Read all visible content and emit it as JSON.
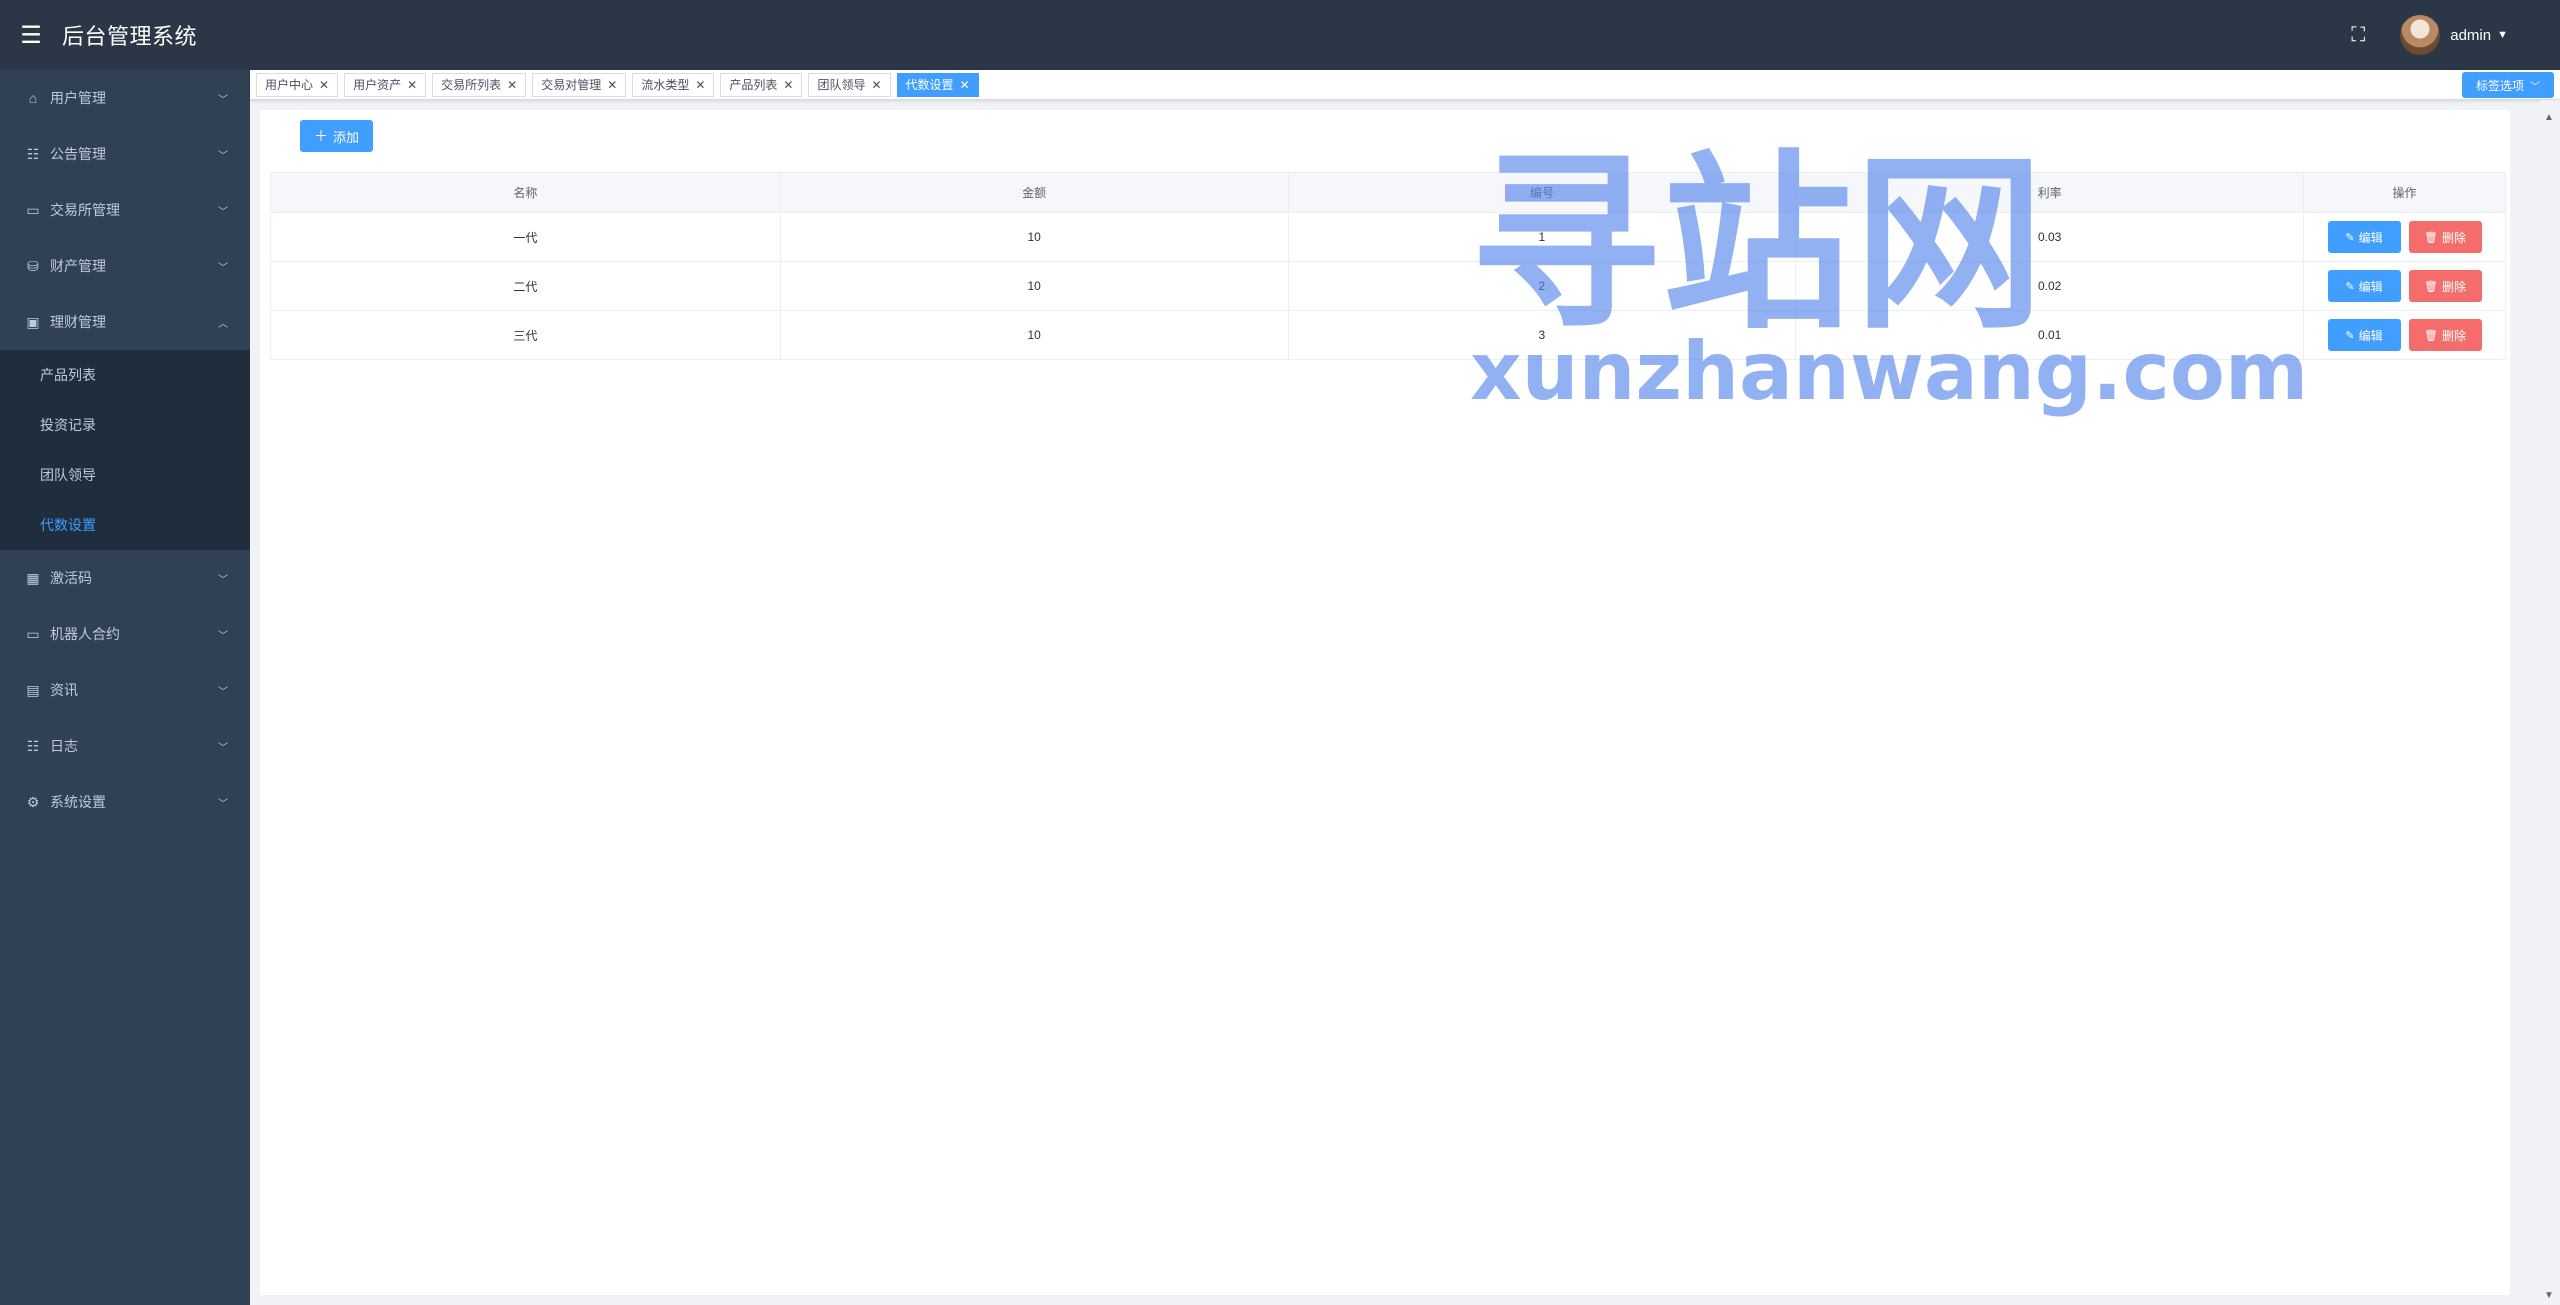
{
  "header": {
    "menu_icon": "hamburger-icon",
    "title": "后台管理系统",
    "fullscreen_icon": "fullscreen-icon",
    "username": "admin"
  },
  "sidebar": {
    "items": [
      {
        "label": "用户管理",
        "icon": "home-icon",
        "expanded": false
      },
      {
        "label": "公告管理",
        "icon": "list-icon",
        "expanded": false
      },
      {
        "label": "交易所管理",
        "icon": "presentation-icon",
        "expanded": false
      },
      {
        "label": "财产管理",
        "icon": "database-icon",
        "expanded": false
      },
      {
        "label": "理财管理",
        "icon": "bag-icon",
        "expanded": true,
        "children": [
          {
            "label": "产品列表",
            "active": false
          },
          {
            "label": "投资记录",
            "active": false
          },
          {
            "label": "团队领导",
            "active": false
          },
          {
            "label": "代数设置",
            "active": true
          }
        ]
      },
      {
        "label": "激活码",
        "icon": "grid-icon",
        "expanded": false
      },
      {
        "label": "机器人合约",
        "icon": "presentation-icon",
        "expanded": false
      },
      {
        "label": "资讯",
        "icon": "document-icon",
        "expanded": false
      },
      {
        "label": "日志",
        "icon": "list-icon",
        "expanded": false
      },
      {
        "label": "系统设置",
        "icon": "gear-icon",
        "expanded": false
      }
    ]
  },
  "tabs": {
    "items": [
      {
        "label": "用户中心",
        "active": false
      },
      {
        "label": "用户资产",
        "active": false
      },
      {
        "label": "交易所列表",
        "active": false
      },
      {
        "label": "交易对管理",
        "active": false
      },
      {
        "label": "流水类型",
        "active": false
      },
      {
        "label": "产品列表",
        "active": false
      },
      {
        "label": "团队领导",
        "active": false
      },
      {
        "label": "代数设置",
        "active": true
      }
    ],
    "options_label": "标签选项"
  },
  "main": {
    "add_label": "添加",
    "table": {
      "columns": [
        "名称",
        "金额",
        "编号",
        "利率",
        "操作"
      ],
      "rows": [
        {
          "name": "一代",
          "amount": "10",
          "number": "1",
          "rate": "0.03"
        },
        {
          "name": "二代",
          "amount": "10",
          "number": "2",
          "rate": "0.02"
        },
        {
          "name": "三代",
          "amount": "10",
          "number": "3",
          "rate": "0.01"
        }
      ],
      "edit_label": "编辑",
      "delete_label": "删除"
    }
  },
  "watermark": {
    "cn": "寻站网",
    "en": "xunzhanwang.com"
  },
  "colors": {
    "header_bg": "#2b3646",
    "sidebar_bg": "#304156",
    "primary": "#409eff",
    "danger": "#f56c6c"
  }
}
